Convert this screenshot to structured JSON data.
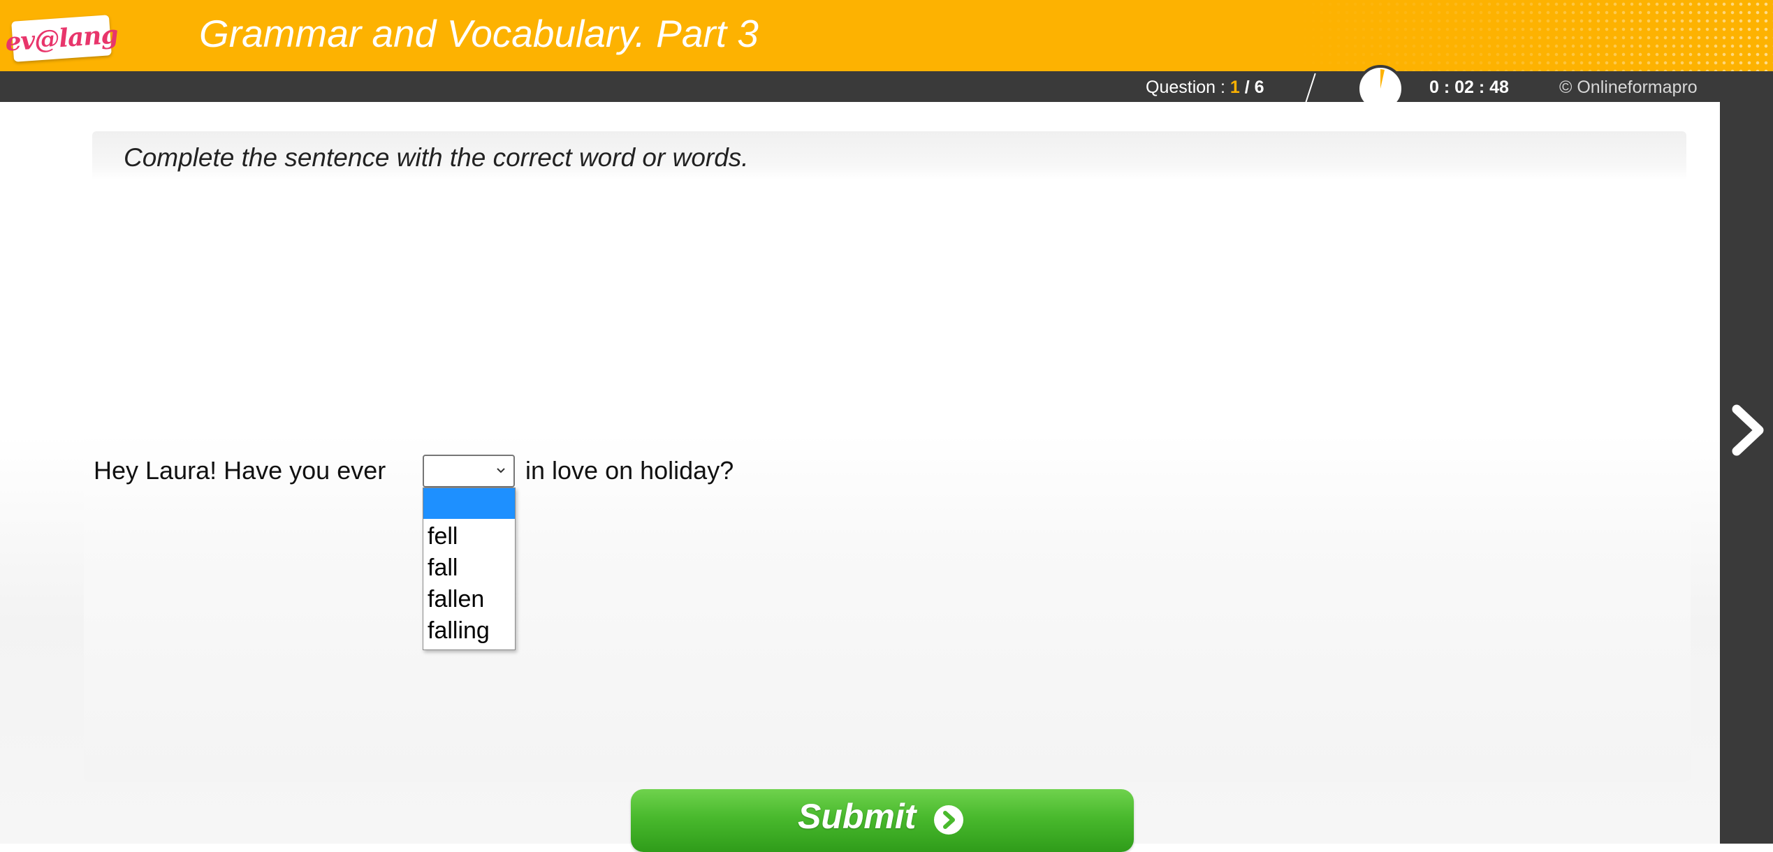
{
  "header": {
    "logo_text": "ev@lang",
    "title": "Grammar and Vocabulary. Part 3"
  },
  "status": {
    "question_label": "Question : ",
    "question_current": "1",
    "question_total": " / 6",
    "timer": "0 : 02 : 48",
    "copyright": "© Onlineformapro"
  },
  "instruction": "Complete the sentence with the correct word or words.",
  "question": {
    "before": "Hey Laura! Have you ever",
    "after": "in love on holiday?",
    "selected_value": "",
    "options": [
      "",
      "fell",
      "fall",
      "fallen",
      "falling"
    ]
  },
  "submit_label": "Submit",
  "colors": {
    "brand_orange": "#fdb201",
    "bar_dark": "#3a3a3a",
    "select_highlight": "#1e90ff",
    "submit_green": "#49b92d"
  },
  "icons": [
    "stopwatch-icon",
    "next-arrow-icon",
    "chevron-down-icon",
    "submit-arrow-icon"
  ]
}
